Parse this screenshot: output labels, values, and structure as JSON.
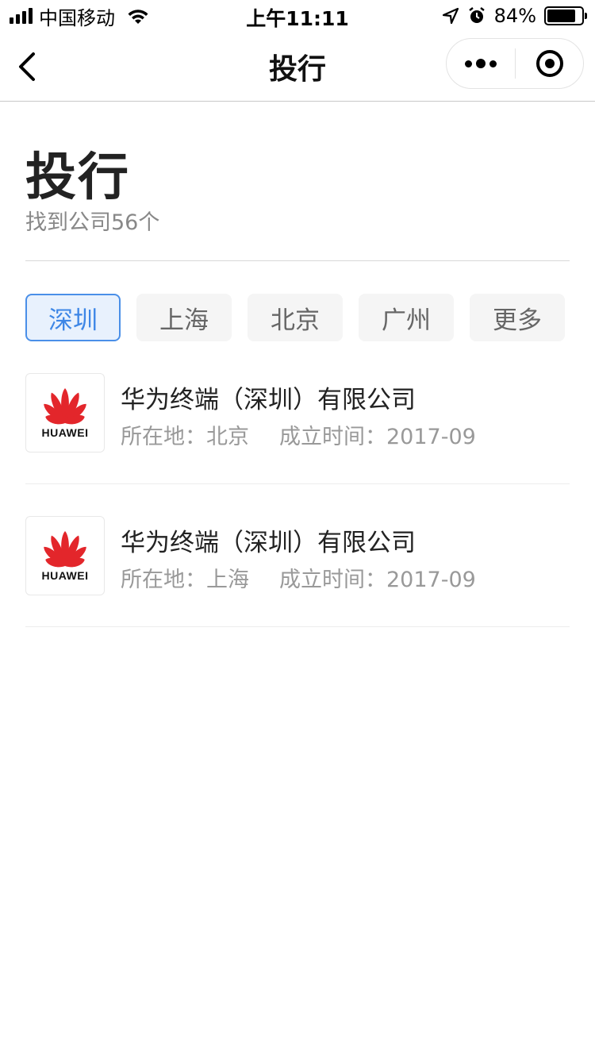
{
  "status_bar": {
    "carrier": "中国移动",
    "time": "上午11:11",
    "battery_percent": "84%",
    "battery_level": 0.84
  },
  "nav": {
    "title": "投行"
  },
  "header": {
    "title": "投行",
    "result_count": "找到公司56个"
  },
  "filters": [
    {
      "label": "深圳",
      "active": true
    },
    {
      "label": "上海",
      "active": false
    },
    {
      "label": "北京",
      "active": false
    },
    {
      "label": "广州",
      "active": false
    },
    {
      "label": "更多",
      "active": false
    }
  ],
  "companies": [
    {
      "logo_text": "HUAWEI",
      "name": "华为终端（深圳）有限公司",
      "location_label": "所在地：",
      "location": "北京",
      "founded_label": "成立时间：",
      "founded": "2017-09"
    },
    {
      "logo_text": "HUAWEI",
      "name": "华为终端（深圳）有限公司",
      "location_label": "所在地：",
      "location": "上海",
      "founded_label": "成立时间：",
      "founded": "2017-09"
    }
  ],
  "colors": {
    "accent": "#3d86e6",
    "accent_bg": "#e8f1fd",
    "huawei_red": "#e3262b"
  }
}
